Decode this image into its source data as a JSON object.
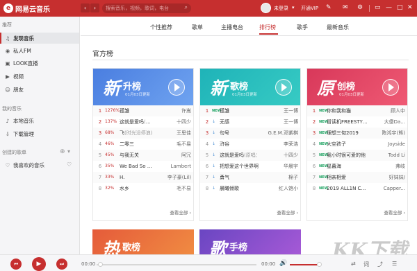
{
  "app": {
    "title": "网易云音乐",
    "logo_glyph": "e"
  },
  "toolbar": {
    "back_glyph": "‹",
    "forward_glyph": "›",
    "search_placeholder": "搜索音乐，视频，歌词，电台",
    "login_label": "未登录",
    "login_arrow": "▾",
    "vip_label": "开通VIP",
    "icons": {
      "skin": "shirt-icon",
      "mail": "mail-icon",
      "settings": "gear-icon",
      "mini": "mini-mode-icon",
      "minimize": "minimize-icon",
      "maximize": "maximize-icon",
      "close": "close-icon"
    },
    "glyphs": {
      "skin": "✎",
      "mail": "✉",
      "settings": "⚙",
      "mini": "▭",
      "minimize": "—",
      "maximize": "□",
      "close": "✕"
    },
    "brand_color": "#c62f2f"
  },
  "sidebar": {
    "recommend_header": "推荐",
    "recommend_items": [
      {
        "label": "发现音乐",
        "icon": "music-note-icon",
        "glyph": "♫",
        "active": true
      },
      {
        "label": "私人FM",
        "icon": "radio-icon",
        "glyph": "◉"
      },
      {
        "label": "LOOK直播",
        "icon": "live-icon",
        "glyph": "▣"
      },
      {
        "label": "视频",
        "icon": "video-icon",
        "glyph": "▶"
      },
      {
        "label": "朋友",
        "icon": "friends-icon",
        "glyph": "☺"
      }
    ],
    "my_music_header": "我的音乐",
    "my_music_items": [
      {
        "label": "本地音乐",
        "icon": "local-music-icon",
        "glyph": "♪"
      },
      {
        "label": "下载管理",
        "icon": "download-icon",
        "glyph": "⇩"
      }
    ],
    "playlist_header": "创建的歌单",
    "playlist_glyphs": {
      "add": "⊕",
      "toggle": "▾"
    },
    "playlist_items": [
      {
        "label": "我喜欢的音乐",
        "icon": "heart-icon",
        "glyph": "♡",
        "right_glyph": "♡",
        "right_icon": "heartbeat-mode-icon"
      }
    ]
  },
  "tabs": [
    {
      "label": "个性推荐"
    },
    {
      "label": "歌单"
    },
    {
      "label": "主播电台"
    },
    {
      "label": "排行榜",
      "active": true
    },
    {
      "label": "歌手"
    },
    {
      "label": "最新音乐"
    }
  ],
  "section_title": "官方榜",
  "charts": [
    {
      "big": "新",
      "small": "升榜",
      "date": "01月03日更新",
      "color_a": "#4a7ee0",
      "color_b": "#6fa3f0",
      "rows": [
        {
          "rank": "1",
          "tag": "1276%",
          "tag_type": "up",
          "title": "孤雏",
          "artist": "许嵩"
        },
        {
          "rank": "2",
          "tag": "137%",
          "tag_type": "up",
          "title": "这就是爱吗",
          "extra": "(原唱：林俊",
          "artist": "十四少"
        },
        {
          "rank": "3",
          "tag": "68%",
          "tag_type": "up",
          "title": "飞",
          "extra": "(时光没停浪)",
          "artist": "王思佳"
        },
        {
          "rank": "4",
          "tag": "46%",
          "tag_type": "up",
          "title": "二零三",
          "artist": "毛不易"
        },
        {
          "rank": "5",
          "tag": "45%",
          "tag_type": "up",
          "title": "与我无关",
          "artist": "阿冗"
        },
        {
          "rank": "6",
          "tag": "35%",
          "tag_type": "up",
          "title": "We Bad So high",
          "artist": "Lambert"
        },
        {
          "rank": "7",
          "tag": "33%",
          "tag_type": "up",
          "title": "H.",
          "artist": "李子豪(Lil)"
        },
        {
          "rank": "8",
          "tag": "32%",
          "tag_type": "up",
          "title": "水乡",
          "artist": "毛不易"
        }
      ],
      "see_all": "查看全部 ›"
    },
    {
      "big": "新",
      "small": "歌榜",
      "date": "01月03日更新",
      "color_a": "#1fb3b8",
      "color_b": "#37cbc4",
      "rows": [
        {
          "rank": "1",
          "tag": "NEW",
          "tag_type": "new",
          "title": "孤雏",
          "artist": "王一博"
        },
        {
          "rank": "2",
          "tag": "↓",
          "tag_type": "down",
          "title": "无感",
          "artist": "王一博"
        },
        {
          "rank": "3",
          "tag": "↓",
          "tag_type": "down",
          "title": "句号",
          "artist": "G.E.M.邓紫棋"
        },
        {
          "rank": "4",
          "tag": "↓",
          "tag_type": "down",
          "title": "浒谷",
          "artist": "李荣浩"
        },
        {
          "rank": "5",
          "tag": "↓",
          "tag_type": "down",
          "title": "这就是爱吗",
          "extra": "(原唱：",
          "artist": "十四少"
        },
        {
          "rank": "6",
          "tag": "↓",
          "tag_type": "down",
          "title": "把想爱这个世界啊",
          "artist": "华晨宇"
        },
        {
          "rank": "7",
          "tag": "↓",
          "tag_type": "down",
          "title": "勇气",
          "artist": "棉子"
        },
        {
          "rank": "8",
          "tag": "↓",
          "tag_type": "down",
          "title": "晨曦倾歌",
          "artist": "红人馆小"
        }
      ],
      "see_all": "查看全部 ›"
    },
    {
      "big": "原",
      "small": "创榜",
      "date": "01月03日更新",
      "color_a": "#d8385a",
      "color_b": "#ef5a74",
      "rows": [
        {
          "rank": "1",
          "tag": "NEW",
          "tag_type": "new",
          "title": "你和我和猫",
          "artist": "顾人中"
        },
        {
          "rank": "2",
          "tag": "NEW",
          "tag_type": "new",
          "title": "冒读机FREESTYLE",
          "artist": "大傻Da..."
        },
        {
          "rank": "3",
          "tag": "NEW",
          "tag_type": "new",
          "title": "理想三旬2019",
          "artist": "陈鸿宇(熊)"
        },
        {
          "rank": "4",
          "tag": "NEW",
          "tag_type": "new",
          "title": "大空孩子",
          "artist": "Joyside"
        },
        {
          "rank": "5",
          "tag": "NEW",
          "tag_type": "new",
          "title": "我小时很可爱的他",
          "artist": "Todd Li"
        },
        {
          "rank": "6",
          "tag": "NEW",
          "tag_type": "new",
          "title": "星暮海",
          "artist": "弗岐"
        },
        {
          "rank": "7",
          "tag": "NEW",
          "tag_type": "new",
          "title": "相亲相爱",
          "artist": "好妹妹/"
        },
        {
          "rank": "8",
          "tag": "NEW",
          "tag_type": "new",
          "title": "2019 ALL1N CYPHER",
          "artist": "Capper..."
        }
      ],
      "see_all": "查看全部 ›"
    }
  ],
  "bottom_cards": [
    {
      "big": "热",
      "small": "歌榜",
      "color_a": "#e55b3a",
      "color_b": "#f08b42"
    },
    {
      "big": "歌",
      "small": "手榜",
      "color_a": "#6a46c2",
      "color_b": "#a559d6"
    }
  ],
  "player": {
    "prev_glyph": "⏮",
    "play_glyph": "▶",
    "next_glyph": "⏭",
    "elapsed": "00:00",
    "total": "00:00",
    "volume": 0.95,
    "volume_glyph": "🔊",
    "right_icons": [
      {
        "name": "play-mode-icon",
        "glyph": "⇄"
      },
      {
        "name": "lyrics-icon",
        "glyph": "词"
      },
      {
        "name": "share-icon",
        "glyph": "⤴"
      },
      {
        "name": "playlist-icon",
        "glyph": "☰"
      }
    ]
  },
  "watermark": "KK下载"
}
